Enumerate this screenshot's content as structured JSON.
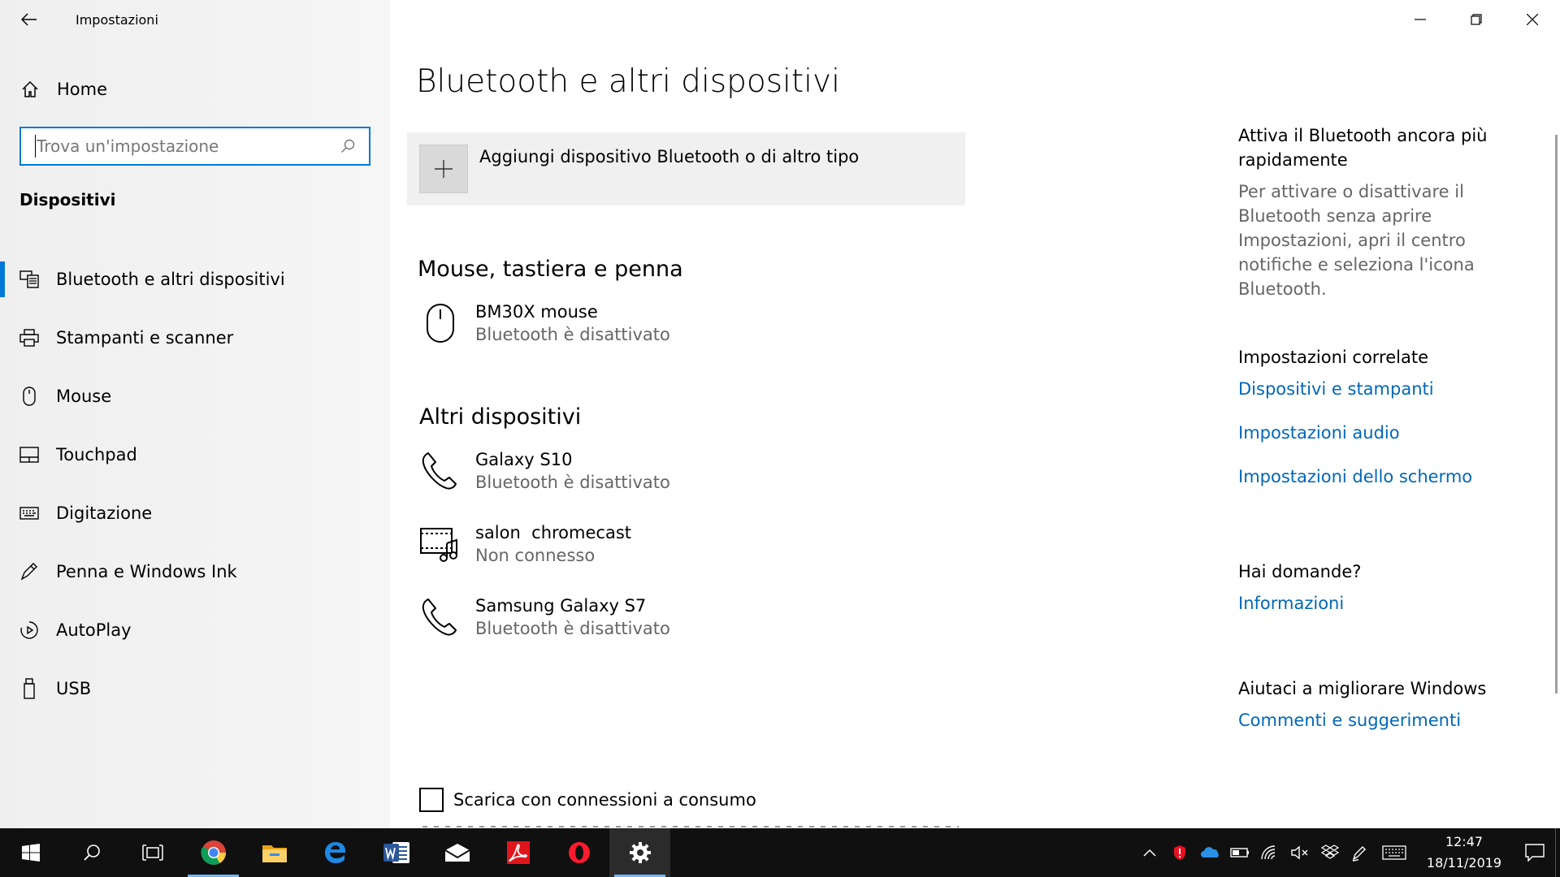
{
  "window": {
    "title": "Impostazioni"
  },
  "sidebar": {
    "home_label": "Home",
    "search_placeholder": "Trova un'impostazione",
    "section_label": "Dispositivi",
    "items": [
      {
        "label": "Bluetooth e altri dispositivi",
        "icon": "bluetooth-devices-icon",
        "active": true
      },
      {
        "label": "Stampanti e scanner",
        "icon": "printer-icon"
      },
      {
        "label": "Mouse",
        "icon": "mouse-icon"
      },
      {
        "label": "Touchpad",
        "icon": "touchpad-icon"
      },
      {
        "label": "Digitazione",
        "icon": "keyboard-icon"
      },
      {
        "label": "Penna e Windows Ink",
        "icon": "pen-icon"
      },
      {
        "label": "AutoPlay",
        "icon": "autoplay-icon"
      },
      {
        "label": "USB",
        "icon": "usb-icon"
      }
    ]
  },
  "main": {
    "title": "Bluetooth e altri dispositivi",
    "add_device_label": "Aggiungi dispositivo Bluetooth o di altro tipo",
    "groups": [
      {
        "title": "Mouse, tastiera e penna",
        "devices": [
          {
            "name": "BM30X mouse",
            "status": "Bluetooth è disattivato",
            "icon": "mouse-icon"
          }
        ]
      },
      {
        "title": "Altri dispositivi",
        "devices": [
          {
            "name": "Galaxy S10",
            "status": "Bluetooth è disattivato",
            "icon": "phone-icon"
          },
          {
            "name": "salon  chromecast",
            "status": "Non connesso",
            "icon": "media-device-icon"
          },
          {
            "name": "Samsung Galaxy S7",
            "status": "Bluetooth è disattivato",
            "icon": "phone-icon"
          }
        ]
      }
    ],
    "metered_label": "Scarica con connessioni a consumo"
  },
  "right": {
    "tip_title": "Attiva il Bluetooth ancora più rapidamente",
    "tip_body": "Per attivare o disattivare il Bluetooth senza aprire Impostazioni, apri il centro notifiche e seleziona l'icona Bluetooth.",
    "related_title": "Impostazioni correlate",
    "related_links": [
      "Dispositivi e stampanti",
      "Impostazioni audio",
      "Impostazioni dello schermo"
    ],
    "questions_title": "Hai domande?",
    "questions_link": "Informazioni",
    "improve_title": "Aiutaci a migliorare Windows",
    "improve_link": "Commenti e suggerimenti"
  },
  "taskbar": {
    "apps": [
      "start-icon",
      "search-icon",
      "task-view-icon",
      "chrome-icon",
      "file-explorer-icon",
      "edge-icon",
      "word-icon",
      "mail-icon",
      "acrobat-icon",
      "opera-icon",
      "settings-icon"
    ],
    "time": "12:47",
    "date": "18/11/2019"
  },
  "colors": {
    "accent": "#0078d7",
    "link": "#0067b8",
    "taskbar": "#101010"
  }
}
